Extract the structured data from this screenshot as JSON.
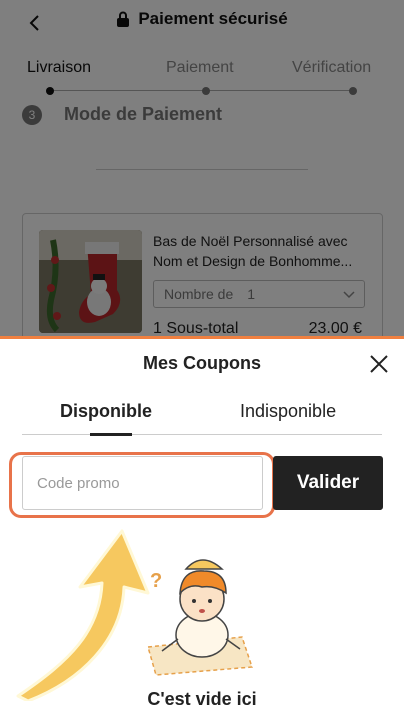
{
  "header": {
    "title": "Paiement sécurisé"
  },
  "steps": [
    {
      "label": "Livraison",
      "active": true
    },
    {
      "label": "Paiement",
      "active": false
    },
    {
      "label": "Vérification",
      "active": false
    }
  ],
  "section": {
    "number": "3",
    "title": "Mode de Paiement"
  },
  "cart": {
    "product_line1": "Bas de Noël Personnalisé avec",
    "product_line2": "Nom et Design de Bonhomme...",
    "qty_label": "Nombre de",
    "qty_value": "1",
    "subtotal_label": "1 Sous-total",
    "subtotal_value": "23.00 €"
  },
  "coupons": {
    "title": "Mes Coupons",
    "tabs": [
      {
        "label": "Disponible",
        "active": true
      },
      {
        "label": "Indisponible",
        "active": false
      }
    ],
    "input_placeholder": "Code promo",
    "input_value": "",
    "validate_label": "Valider",
    "empty_text": "C'est vide ici"
  },
  "colors": {
    "highlight": "#e8734a",
    "arrow": "#f6c85f",
    "button": "#222222"
  },
  "icons": [
    "back-icon",
    "lock-icon",
    "chevron-down-icon",
    "close-icon"
  ]
}
